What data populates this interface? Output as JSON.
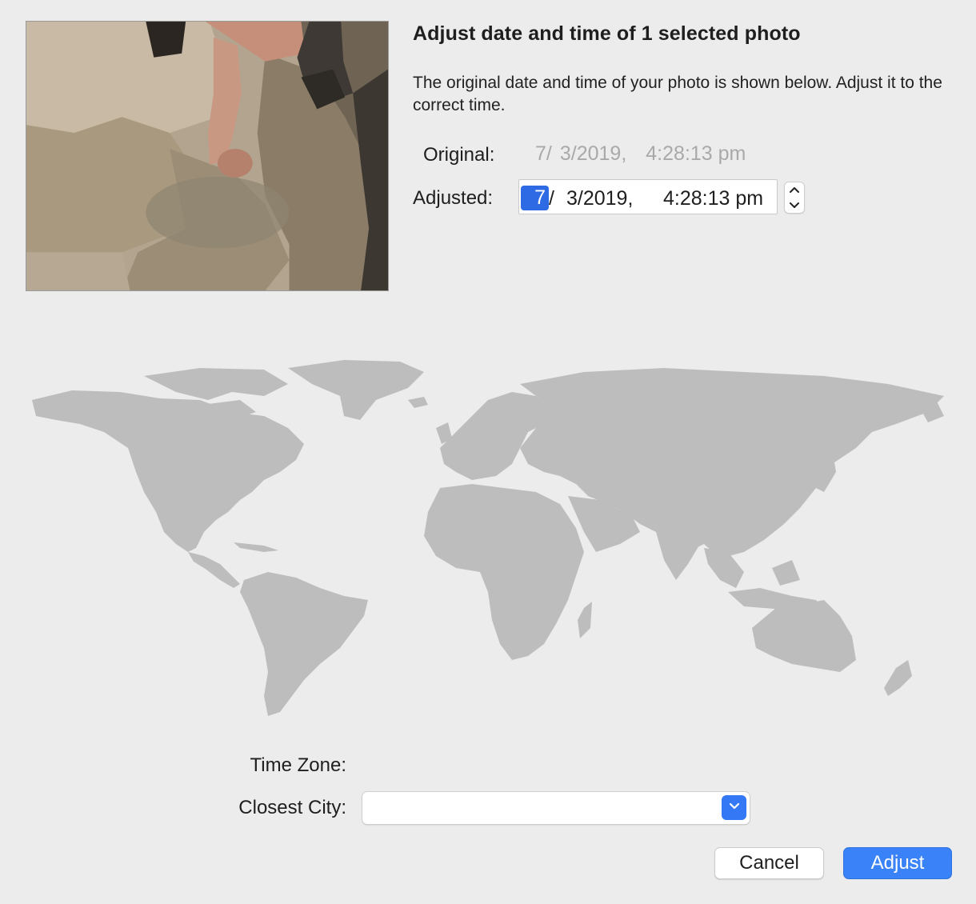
{
  "dialog": {
    "title": "Adjust date and time of 1 selected photo",
    "description": "The original date and time of your photo is shown below. Adjust it to the correct time."
  },
  "original": {
    "label": "Original:",
    "month": "7/",
    "date": "3/2019,",
    "time": "4:28:13 pm"
  },
  "adjusted": {
    "label": "Adjusted:",
    "month": "7",
    "slash": "/",
    "date": "3/2019,",
    "time": "4:28:13 pm"
  },
  "timezone": {
    "label": "Time Zone:",
    "value": ""
  },
  "city": {
    "label": "Closest City:",
    "value": ""
  },
  "buttons": {
    "cancel": "Cancel",
    "adjust": "Adjust"
  },
  "colors": {
    "accent": "#3a82f7",
    "selection": "#2d6ae3",
    "map_land": "#bdbdbd",
    "disabled_text": "#a9a9a9"
  },
  "icons": {
    "stepper_up": "chevron-up-icon",
    "stepper_down": "chevron-down-icon",
    "select_arrow": "chevron-down-icon"
  }
}
